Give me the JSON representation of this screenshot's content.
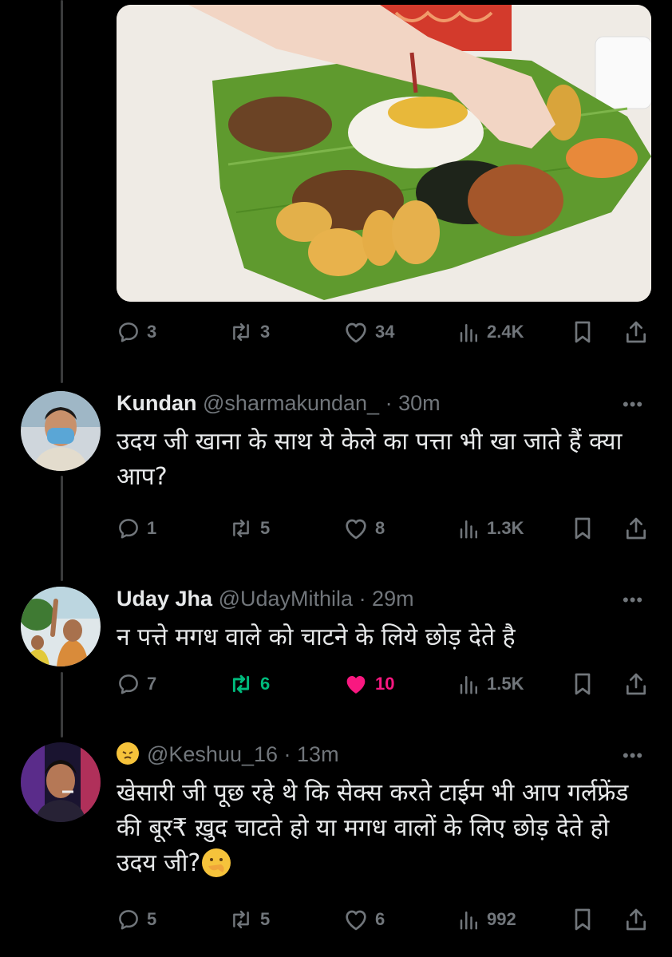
{
  "post": {
    "image_alt": "Hand eating food served on a banana leaf",
    "actions": {
      "replies": "3",
      "reposts": "3",
      "likes": "34",
      "views": "2.4K"
    }
  },
  "replies": [
    {
      "name": "Kundan",
      "handle": "@sharmakundan_",
      "time": "· 30m",
      "text": "उदय जी खाना के साथ ये केले का पत्ता भी खा जाते हैं क्या आप?",
      "actions": {
        "replies": "1",
        "reposts": "5",
        "likes": "8",
        "views": "1.3K"
      },
      "reposted": false,
      "liked": false
    },
    {
      "name": "Uday Jha",
      "handle": "@UdayMithila",
      "time": "· 29m",
      "text": "न पत्ते मगध वाले को चाटने के लिये छोड़ देते है",
      "actions": {
        "replies": "7",
        "reposts": "6",
        "likes": "10",
        "views": "1.5K"
      },
      "reposted": true,
      "liked": true
    },
    {
      "name": "😾",
      "handle": "@Keshuu_16",
      "time": "· 13m",
      "text": "खेसारी जी पूछ रहे थे कि सेक्स करते टाईम भी आप गर्लफ्रेंड की बूर₹ ख़ुद चाटते हो या मगध वालों के लिए छोड़ देते हो उदय जी?",
      "text_emoji": "🤭",
      "actions": {
        "replies": "5",
        "reposts": "5",
        "likes": "6",
        "views": "992"
      },
      "reposted": false,
      "liked": false
    }
  ],
  "more_label": "•••",
  "colors": {
    "background": "#000000",
    "muted": "#71767b",
    "repost_active": "#00ba7c",
    "like_active": "#f91880"
  }
}
